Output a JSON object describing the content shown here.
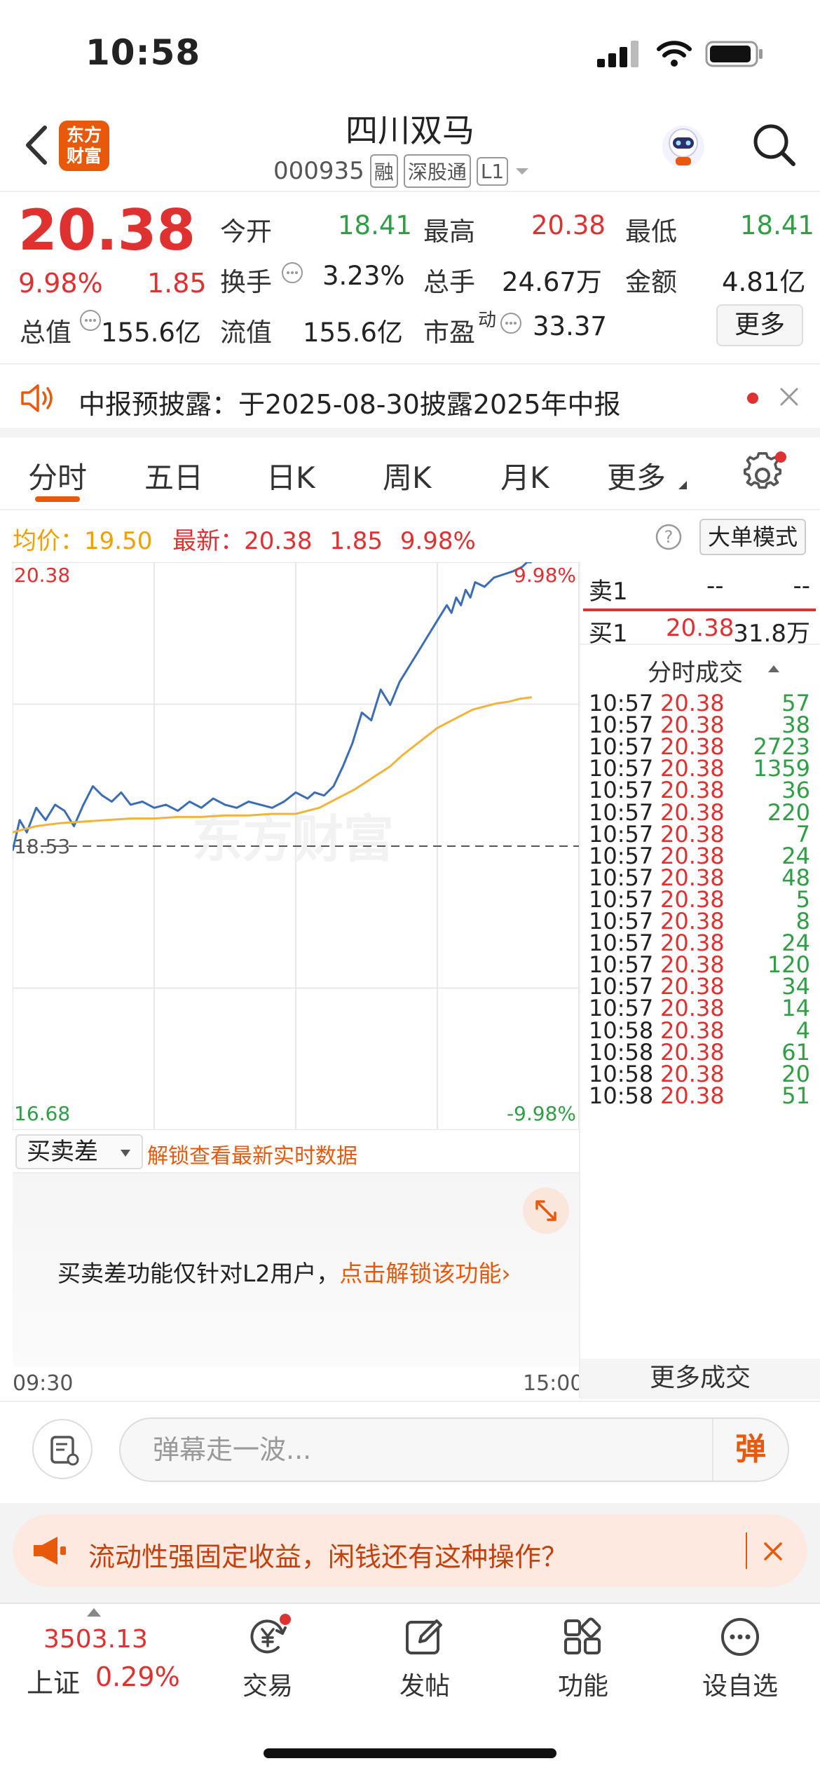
{
  "status": {
    "time": "10:58"
  },
  "header": {
    "logo_line1": "东方",
    "logo_line2": "财富",
    "stock_name": "四川双马",
    "stock_code": "000935",
    "tags": [
      "融",
      "深股通",
      "L1"
    ]
  },
  "quote": {
    "price": "20.38",
    "pct": "9.98%",
    "change": "1.85",
    "open_label": "今开",
    "open": "18.41",
    "high_label": "最高",
    "high": "20.38",
    "low_label": "最低",
    "low": "18.41",
    "turnover_label": "换手",
    "turnover": "3.23%",
    "volume_label": "总手",
    "volume": "24.67万",
    "amount_label": "金额",
    "amount": "4.81亿",
    "mktcap_label": "总值",
    "mktcap": "155.6亿",
    "float_label": "流值",
    "float": "155.6亿",
    "pe_label": "市盈",
    "pe_sup": "动",
    "pe": "33.37",
    "more": "更多"
  },
  "notice": {
    "text": "中报预披露：于2025-08-30披露2025年中报"
  },
  "tabs": [
    "分时",
    "五日",
    "日K",
    "周K",
    "月K",
    "更多"
  ],
  "info": {
    "avg_label": "均价：",
    "avg": "19.50",
    "latest_label": "最新：",
    "latest": "20.38",
    "change": "1.85",
    "pct": "9.98%",
    "big_order": "大单模式"
  },
  "chart_data": {
    "type": "line",
    "top_left": "20.38",
    "top_right": "9.98%",
    "bottom_left": "16.68",
    "bottom_right": "-9.98%",
    "prev_close_label": "18.53",
    "watermark": "东方财富",
    "ylim": [
      16.68,
      20.38
    ],
    "prev_close": 18.53,
    "x_start": "09:30",
    "x_end": "15:00",
    "series": [
      {
        "name": "price",
        "color": "#3b6db5",
        "x": [
          0,
          3,
          6,
          10,
          14,
          18,
          22,
          26,
          30,
          34,
          38,
          42,
          46,
          50,
          55,
          60,
          65,
          70,
          75,
          80,
          85,
          90,
          95,
          100,
          105,
          110,
          115,
          120,
          125,
          128,
          132,
          136,
          140,
          144,
          148,
          152,
          156,
          160,
          164,
          168,
          172,
          176,
          180,
          184,
          186,
          188,
          190,
          192,
          194,
          196,
          200,
          204,
          208,
          212,
          216,
          218,
          220
        ],
        "y": [
          18.5,
          18.7,
          18.62,
          18.78,
          18.7,
          18.8,
          18.76,
          18.66,
          18.8,
          18.92,
          18.86,
          18.82,
          18.88,
          18.8,
          18.82,
          18.78,
          18.8,
          18.76,
          18.82,
          18.78,
          18.84,
          18.8,
          18.78,
          18.82,
          18.8,
          18.78,
          18.82,
          18.88,
          18.84,
          18.88,
          18.86,
          18.92,
          19.05,
          19.2,
          19.4,
          19.35,
          19.55,
          19.45,
          19.6,
          19.7,
          19.8,
          19.9,
          20.0,
          20.1,
          20.05,
          20.15,
          20.1,
          20.2,
          20.15,
          20.25,
          20.22,
          20.28,
          20.3,
          20.32,
          20.35,
          20.38,
          20.38
        ]
      },
      {
        "name": "avg",
        "color": "#f0b43c",
        "x": [
          0,
          10,
          20,
          30,
          40,
          50,
          60,
          70,
          80,
          90,
          100,
          110,
          120,
          125,
          130,
          135,
          140,
          145,
          150,
          155,
          160,
          165,
          170,
          175,
          180,
          185,
          190,
          195,
          200,
          205,
          210,
          215,
          220
        ],
        "y": [
          18.62,
          18.66,
          18.68,
          18.69,
          18.7,
          18.71,
          18.71,
          18.72,
          18.72,
          18.73,
          18.73,
          18.74,
          18.74,
          18.76,
          18.78,
          18.82,
          18.86,
          18.9,
          18.95,
          19.0,
          19.05,
          19.12,
          19.18,
          19.24,
          19.3,
          19.34,
          19.38,
          19.42,
          19.44,
          19.46,
          19.47,
          19.49,
          19.5
        ]
      }
    ],
    "x_domain": [
      0,
      240
    ]
  },
  "orderbook": {
    "sell1_label": "卖1",
    "sell1_price": "--",
    "sell1_vol": "--",
    "buy1_label": "买1",
    "buy1_price": "20.38",
    "buy1_vol": "31.8万"
  },
  "ticks": {
    "title": "分时成交",
    "rows": [
      {
        "t": "10:57",
        "p": "20.38",
        "v": "57"
      },
      {
        "t": "10:57",
        "p": "20.38",
        "v": "38"
      },
      {
        "t": "10:57",
        "p": "20.38",
        "v": "2723"
      },
      {
        "t": "10:57",
        "p": "20.38",
        "v": "1359"
      },
      {
        "t": "10:57",
        "p": "20.38",
        "v": "36"
      },
      {
        "t": "10:57",
        "p": "20.38",
        "v": "220"
      },
      {
        "t": "10:57",
        "p": "20.38",
        "v": "7"
      },
      {
        "t": "10:57",
        "p": "20.38",
        "v": "24"
      },
      {
        "t": "10:57",
        "p": "20.38",
        "v": "48"
      },
      {
        "t": "10:57",
        "p": "20.38",
        "v": "5"
      },
      {
        "t": "10:57",
        "p": "20.38",
        "v": "8"
      },
      {
        "t": "10:57",
        "p": "20.38",
        "v": "24"
      },
      {
        "t": "10:57",
        "p": "20.38",
        "v": "120"
      },
      {
        "t": "10:57",
        "p": "20.38",
        "v": "34"
      },
      {
        "t": "10:57",
        "p": "20.38",
        "v": "14"
      },
      {
        "t": "10:58",
        "p": "20.38",
        "v": "4"
      },
      {
        "t": "10:58",
        "p": "20.38",
        "v": "61"
      },
      {
        "t": "10:58",
        "p": "20.38",
        "v": "20"
      },
      {
        "t": "10:58",
        "p": "20.38",
        "v": "51"
      }
    ],
    "more": "更多成交"
  },
  "subchart": {
    "dropdown": "买卖差",
    "unlock_link": "解锁查看最新实时数据",
    "msg_prefix": "买卖差功能仅针对L2用户，",
    "msg_link": "点击解锁该功能",
    "time_start": "09:30",
    "time_end": "15:00"
  },
  "danmu": {
    "placeholder": "弹幕走一波...",
    "button": "弹"
  },
  "ad": {
    "text": "流动性强固定收益，闲钱还有这种操作？"
  },
  "bottom_nav": {
    "index_value": "3503.13",
    "index_name": "上证",
    "index_pct": "0.29%",
    "items": [
      "交易",
      "发帖",
      "功能",
      "设自选"
    ]
  }
}
